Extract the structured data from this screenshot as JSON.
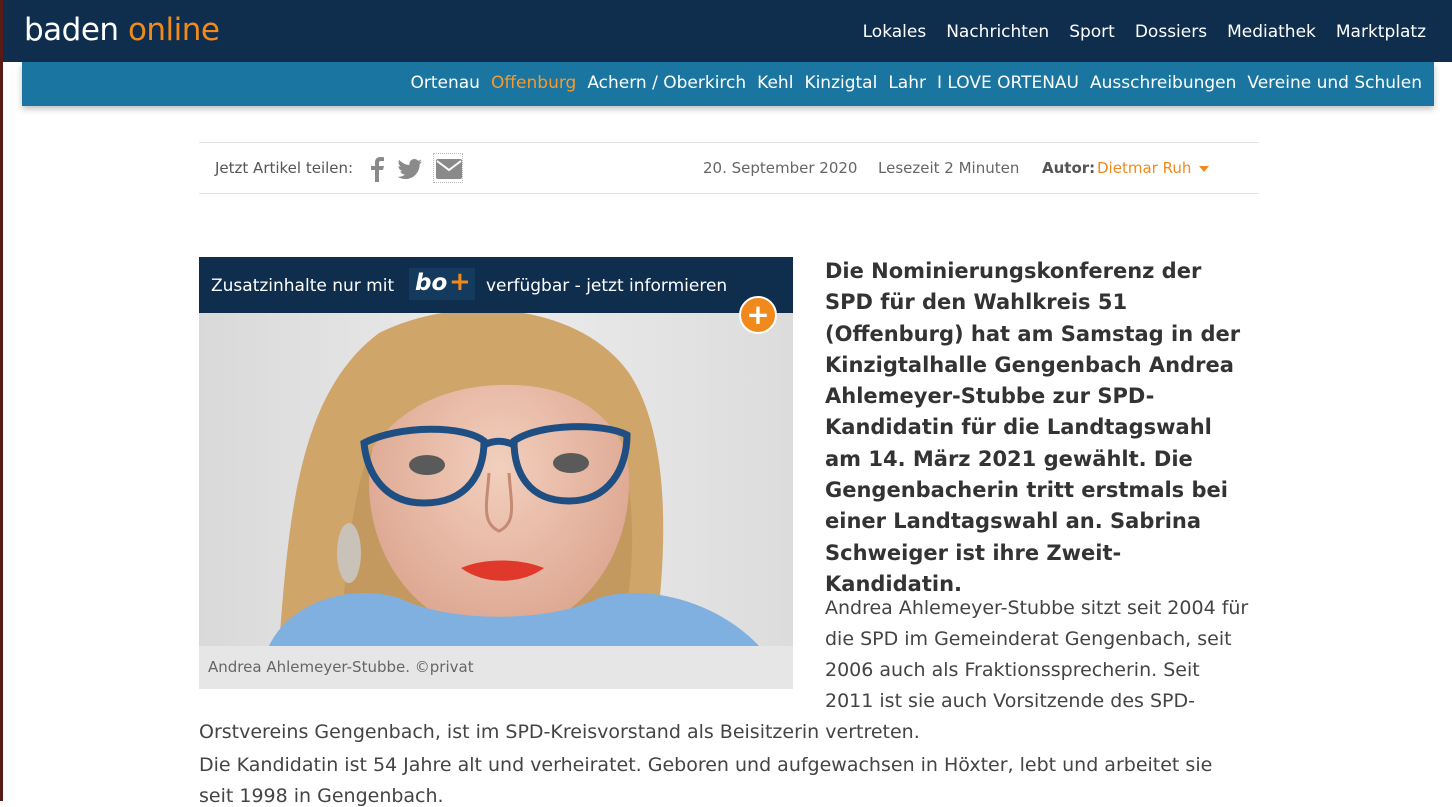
{
  "header": {
    "logo_word1": "baden",
    "logo_word2": "online",
    "main_nav": [
      "Lokales",
      "Nachrichten",
      "Sport",
      "Dossiers",
      "Mediathek",
      "Marktplatz"
    ],
    "sub_nav": [
      "Ortenau",
      "Offenburg",
      "Achern / Oberkirch",
      "Kehl",
      "Kinzigtal",
      "Lahr",
      "I LOVE ORTENAU",
      "Ausschreibungen",
      "Vereine und Schulen"
    ],
    "active_sub_nav": "Offenburg"
  },
  "meta": {
    "share_label": "Jetzt Artikel teilen:",
    "date": "20. September 2020",
    "read_time": "Lesezeit 2 Minuten",
    "author_label": "Autor:",
    "author_name": "Dietmar Ruh"
  },
  "figure": {
    "promo_pre": "Zusatzinhalte nur mit",
    "promo_badge": "bo",
    "promo_badge_plus": "+",
    "promo_post": "verfügbar - jetzt informieren",
    "plus_symbol": "+",
    "caption": "Andrea Ahlemeyer-Stubbe. ©privat"
  },
  "article": {
    "lead": "Die Nominierungskonferenz der SPD für den Wahlkreis 51 (Offenburg) hat am Samstag in der Kinzigtalhalle Gengenbach Andrea Ahlemeyer-Stubbe zur SPD-Kandidatin für die Landtagswahl am 14. März 2021 gewählt. Die Gengenbacherin tritt erstmals bei einer Landtagswahl an. Sabrina Schweiger ist ihre Zweit-Kandidatin.",
    "p1_lines": [
      "Andrea Ahlemeyer-Stubbe sitzt seit 2004 für",
      "die SPD im Gemeinderat Gengenbach, seit",
      "2006  auch als Fraktionssprecherin. Seit",
      "2011 ist sie auch Vorsitzende des SPD-",
      "Orstvereins Gengenbach, ist im SPD-Kreisvorstand als Beisitzerin vertreten."
    ],
    "p2_lines": [
      "Die Kandidatin ist 54 Jahre alt und verheiratet. Geboren und aufgewachsen in Höxter, lebt und arbeitet sie",
      "seit 1998 in Gengenbach."
    ]
  },
  "colors": {
    "header_bg": "#0f2e4e",
    "subnav_bg": "#1a76a0",
    "accent": "#f08a1c"
  },
  "icons": [
    "facebook-icon",
    "twitter-icon",
    "mail-icon",
    "plus-icon",
    "chevron-down-icon"
  ]
}
